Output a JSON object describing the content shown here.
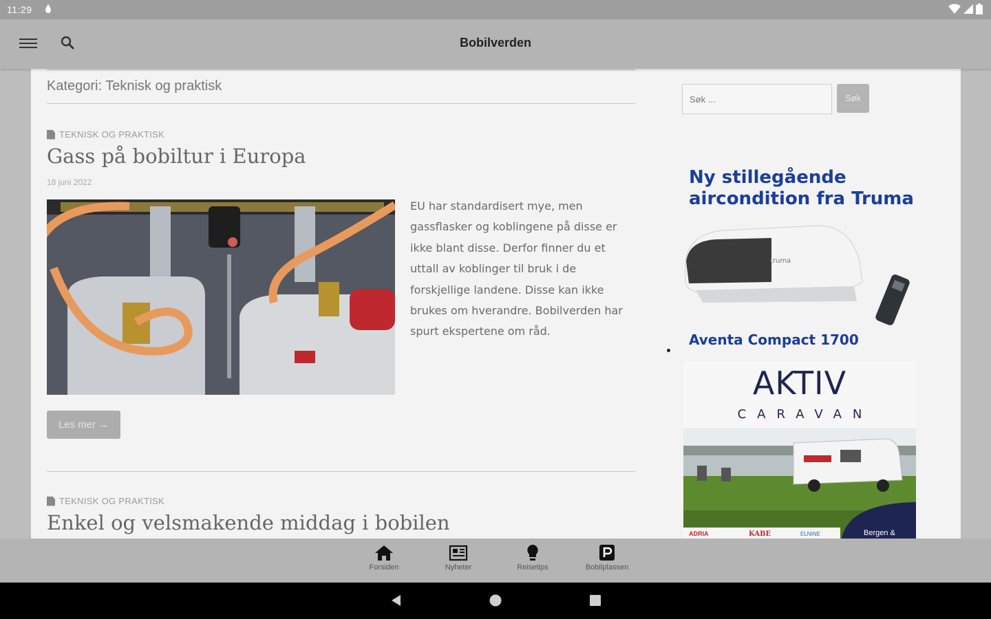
{
  "status_bar": {
    "time": "11:29"
  },
  "app_bar": {
    "title": "Bobilverden"
  },
  "archive": {
    "category_title": "Kategori: Teknisk og praktisk"
  },
  "posts": [
    {
      "category": "TEKNISK OG PRAKTISK",
      "title": "Gass på bobiltur i Europa",
      "date": "18 juni 2022",
      "excerpt": "EU har standardisert mye, men gassflasker og koblingene på disse er ikke blant disse. Derfor finner du et uttall av koblinger til bruk i de forskjellige landene. Disse kan ikke brukes om hverandre. Bobilverden har spurt ekspertene om råd.",
      "read_more": "Les mer →"
    },
    {
      "category": "TEKNISK OG PRAKTISK",
      "title": "Enkel og velsmakende middag i bobilen"
    }
  ],
  "sidebar": {
    "search_placeholder": "Søk ...",
    "search_button": "Søk",
    "ad_truma": {
      "headline_line1": "Ny stillegående",
      "headline_line2": "aircondition fra Truma",
      "product": "Aventa Compact 1700",
      "unit_label": "truma"
    },
    "ad_aktiv": {
      "brand": "AKTIV",
      "sub": "CARAVAN",
      "badge": "Bergen &",
      "logos": [
        "ADRIA",
        "KABE",
        "ELNINE"
      ]
    }
  },
  "bottom_nav": {
    "items": [
      {
        "label": "Forsiden",
        "icon": "home-icon"
      },
      {
        "label": "Nyheter",
        "icon": "newspaper-icon"
      },
      {
        "label": "Reisetips",
        "icon": "lightbulb-icon"
      },
      {
        "label": "Bobilplassen",
        "icon": "parking-icon"
      }
    ]
  },
  "colors": {
    "ad_blue": "#1a3e9a",
    "aktiv_navy": "#1f2552",
    "aktiv_orange": "#f39a1e"
  }
}
